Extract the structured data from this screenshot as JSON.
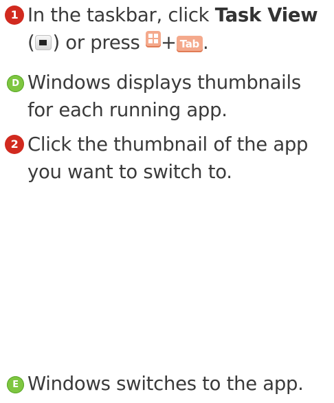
{
  "steps": [
    {
      "badge": "1",
      "text_a": "In the taskbar, click ",
      "bold": "Task View",
      "text_b": "(",
      "text_c": ") or press ",
      "plus": "+",
      "key_tab": "Tab",
      "end": "."
    },
    {
      "badge": "D",
      "text": "Windows displays thumbnails for each running app."
    },
    {
      "badge": "2",
      "text": "Click the thumbnail of the app you want to switch to."
    },
    {
      "badge": "E",
      "text": "Windows switches to the app."
    }
  ],
  "icons": [
    "task-view-icon",
    "windows-key-icon"
  ],
  "colors": {
    "step_badge": "#d12a1f",
    "callout_badge": "#7ec640",
    "key": "#f4a98c",
    "text": "#3a3a3a"
  }
}
